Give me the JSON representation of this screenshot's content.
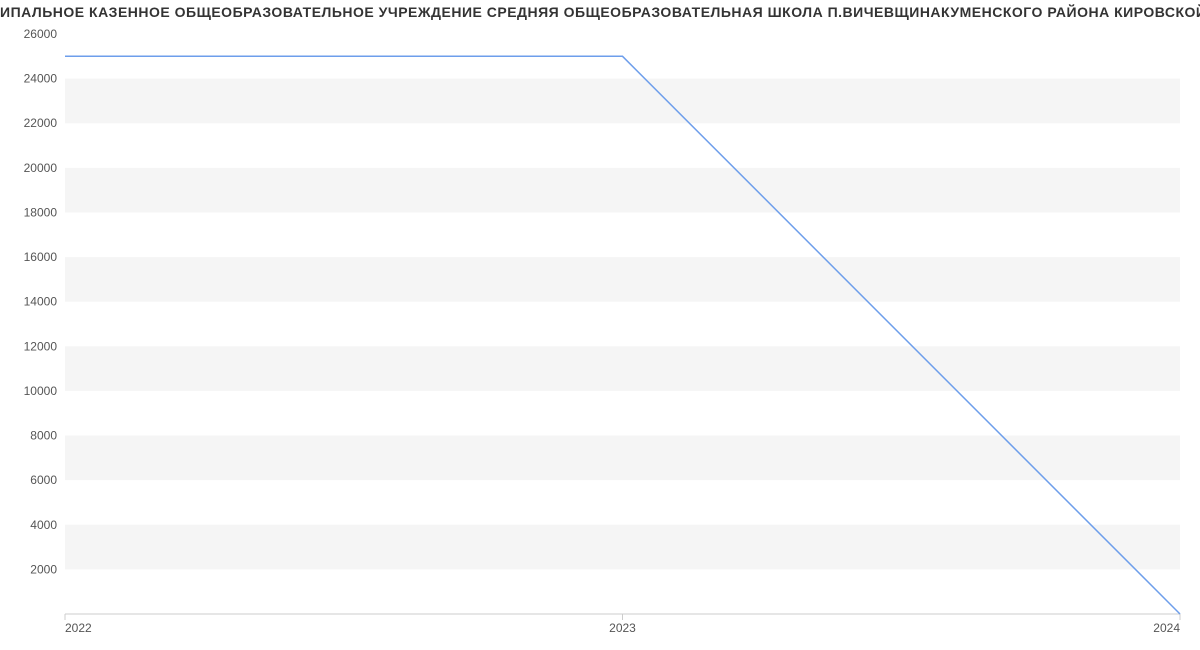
{
  "title": "ИПАЛЬНОЕ КАЗЕННОЕ ОБЩЕОБРАЗОВАТЕЛЬНОЕ УЧРЕЖДЕНИЕ СРЕДНЯЯ ОБЩЕОБРАЗОВАТЕЛЬНАЯ ШКОЛА П.ВИЧЕВЩИНАКУМЕНСКОГО РАЙОНА КИРОВСКОЙ ОБЛАСТИ |",
  "chart_data": {
    "type": "line",
    "x": [
      2022,
      2023,
      2024
    ],
    "values": [
      25000,
      25000,
      0
    ],
    "title": "ИПАЛЬНОЕ КАЗЕННОЕ ОБЩЕОБРАЗОВАТЕЛЬНОЕ УЧРЕЖДЕНИЕ СРЕДНЯЯ ОБЩЕОБРАЗОВАТЕЛЬНАЯ ШКОЛА П.ВИЧЕВЩИНАКУМЕНСКОГО РАЙОНА КИРОВСКОЙ ОБЛАСТИ |",
    "xlabel": "",
    "ylabel": "",
    "ylim": [
      0,
      26000
    ],
    "xlim": [
      2022,
      2024
    ],
    "y_ticks": [
      2000,
      4000,
      6000,
      8000,
      10000,
      12000,
      14000,
      16000,
      18000,
      20000,
      22000,
      24000,
      26000
    ],
    "x_ticks": [
      2022,
      2023,
      2024
    ],
    "line_color": "#6d9eeb"
  }
}
